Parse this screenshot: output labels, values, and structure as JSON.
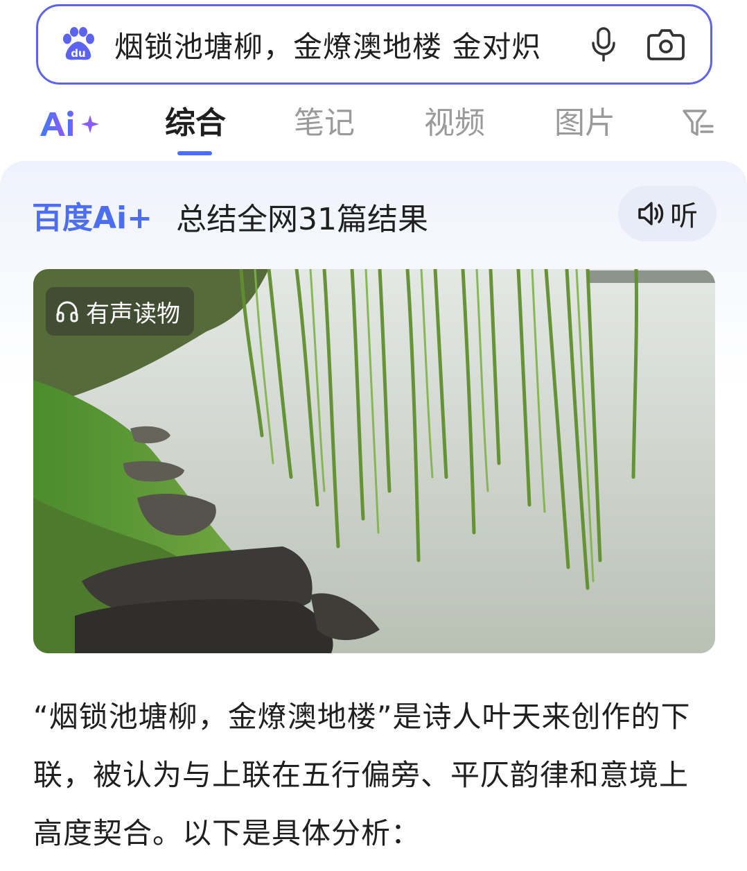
{
  "search": {
    "query": "烟锁池塘柳，金燎澳地楼 金对炽",
    "icon_logo": "baidu-paw-icon",
    "icon_mic": "microphone-icon",
    "icon_camera": "camera-icon"
  },
  "tabs": {
    "items": [
      {
        "label": "综合",
        "active": true
      },
      {
        "label": "笔记",
        "active": false
      },
      {
        "label": "视频",
        "active": false
      },
      {
        "label": "图片",
        "active": false
      }
    ],
    "filter_icon": "filter-icon",
    "ai_logo": "Ai+"
  },
  "ai_card": {
    "brand": "百度Ai+",
    "summary": "总结全网31篇结果",
    "listen_label": "听",
    "audio_badge": "有声读物",
    "answer": "“烟锁池塘柳，金燎澳地楼”是诗人叶天来创作的下联，被认为与上联在五行偏旁、平仄韵律和意境上高度契合。以下是具体分析："
  },
  "colors": {
    "accent": "#4e6ef2",
    "search_border": "#5b63f0",
    "brand_blue": "#4e6ef2",
    "brand_purple": "#8a5cf6",
    "listen_bg": "#e8ecf6"
  }
}
